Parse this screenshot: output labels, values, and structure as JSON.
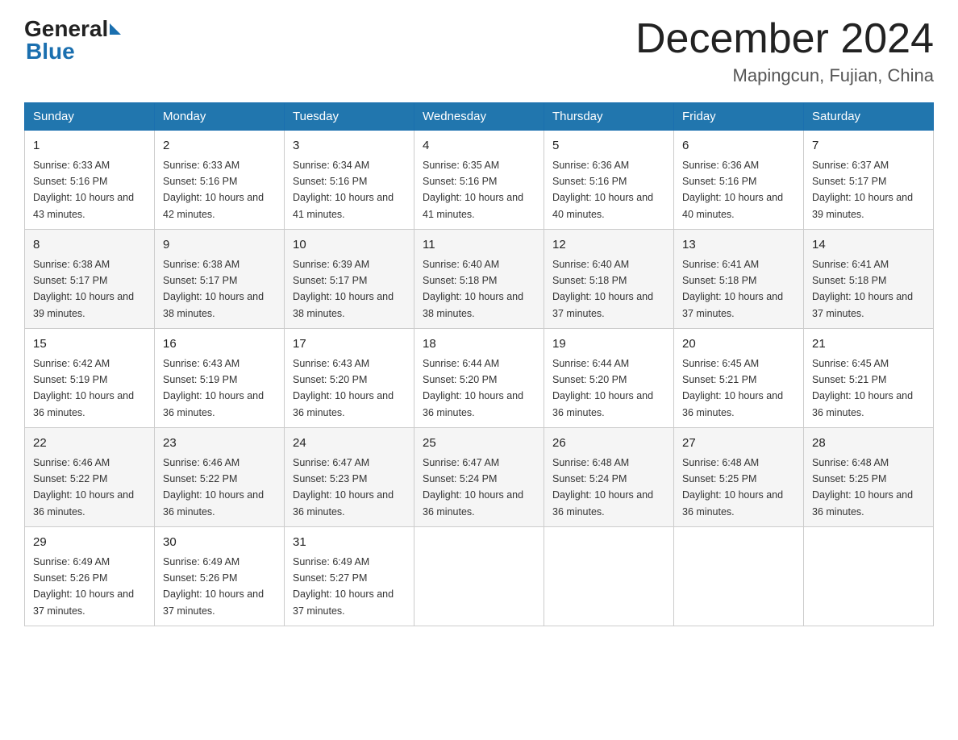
{
  "header": {
    "logo_general": "General",
    "logo_blue": "Blue",
    "month_title": "December 2024",
    "location": "Mapingcun, Fujian, China"
  },
  "days_of_week": [
    "Sunday",
    "Monday",
    "Tuesday",
    "Wednesday",
    "Thursday",
    "Friday",
    "Saturday"
  ],
  "weeks": [
    [
      {
        "day": "1",
        "sunrise": "6:33 AM",
        "sunset": "5:16 PM",
        "daylight": "10 hours and 43 minutes."
      },
      {
        "day": "2",
        "sunrise": "6:33 AM",
        "sunset": "5:16 PM",
        "daylight": "10 hours and 42 minutes."
      },
      {
        "day": "3",
        "sunrise": "6:34 AM",
        "sunset": "5:16 PM",
        "daylight": "10 hours and 41 minutes."
      },
      {
        "day": "4",
        "sunrise": "6:35 AM",
        "sunset": "5:16 PM",
        "daylight": "10 hours and 41 minutes."
      },
      {
        "day": "5",
        "sunrise": "6:36 AM",
        "sunset": "5:16 PM",
        "daylight": "10 hours and 40 minutes."
      },
      {
        "day": "6",
        "sunrise": "6:36 AM",
        "sunset": "5:16 PM",
        "daylight": "10 hours and 40 minutes."
      },
      {
        "day": "7",
        "sunrise": "6:37 AM",
        "sunset": "5:17 PM",
        "daylight": "10 hours and 39 minutes."
      }
    ],
    [
      {
        "day": "8",
        "sunrise": "6:38 AM",
        "sunset": "5:17 PM",
        "daylight": "10 hours and 39 minutes."
      },
      {
        "day": "9",
        "sunrise": "6:38 AM",
        "sunset": "5:17 PM",
        "daylight": "10 hours and 38 minutes."
      },
      {
        "day": "10",
        "sunrise": "6:39 AM",
        "sunset": "5:17 PM",
        "daylight": "10 hours and 38 minutes."
      },
      {
        "day": "11",
        "sunrise": "6:40 AM",
        "sunset": "5:18 PM",
        "daylight": "10 hours and 38 minutes."
      },
      {
        "day": "12",
        "sunrise": "6:40 AM",
        "sunset": "5:18 PM",
        "daylight": "10 hours and 37 minutes."
      },
      {
        "day": "13",
        "sunrise": "6:41 AM",
        "sunset": "5:18 PM",
        "daylight": "10 hours and 37 minutes."
      },
      {
        "day": "14",
        "sunrise": "6:41 AM",
        "sunset": "5:18 PM",
        "daylight": "10 hours and 37 minutes."
      }
    ],
    [
      {
        "day": "15",
        "sunrise": "6:42 AM",
        "sunset": "5:19 PM",
        "daylight": "10 hours and 36 minutes."
      },
      {
        "day": "16",
        "sunrise": "6:43 AM",
        "sunset": "5:19 PM",
        "daylight": "10 hours and 36 minutes."
      },
      {
        "day": "17",
        "sunrise": "6:43 AM",
        "sunset": "5:20 PM",
        "daylight": "10 hours and 36 minutes."
      },
      {
        "day": "18",
        "sunrise": "6:44 AM",
        "sunset": "5:20 PM",
        "daylight": "10 hours and 36 minutes."
      },
      {
        "day": "19",
        "sunrise": "6:44 AM",
        "sunset": "5:20 PM",
        "daylight": "10 hours and 36 minutes."
      },
      {
        "day": "20",
        "sunrise": "6:45 AM",
        "sunset": "5:21 PM",
        "daylight": "10 hours and 36 minutes."
      },
      {
        "day": "21",
        "sunrise": "6:45 AM",
        "sunset": "5:21 PM",
        "daylight": "10 hours and 36 minutes."
      }
    ],
    [
      {
        "day": "22",
        "sunrise": "6:46 AM",
        "sunset": "5:22 PM",
        "daylight": "10 hours and 36 minutes."
      },
      {
        "day": "23",
        "sunrise": "6:46 AM",
        "sunset": "5:22 PM",
        "daylight": "10 hours and 36 minutes."
      },
      {
        "day": "24",
        "sunrise": "6:47 AM",
        "sunset": "5:23 PM",
        "daylight": "10 hours and 36 minutes."
      },
      {
        "day": "25",
        "sunrise": "6:47 AM",
        "sunset": "5:24 PM",
        "daylight": "10 hours and 36 minutes."
      },
      {
        "day": "26",
        "sunrise": "6:48 AM",
        "sunset": "5:24 PM",
        "daylight": "10 hours and 36 minutes."
      },
      {
        "day": "27",
        "sunrise": "6:48 AM",
        "sunset": "5:25 PM",
        "daylight": "10 hours and 36 minutes."
      },
      {
        "day": "28",
        "sunrise": "6:48 AM",
        "sunset": "5:25 PM",
        "daylight": "10 hours and 36 minutes."
      }
    ],
    [
      {
        "day": "29",
        "sunrise": "6:49 AM",
        "sunset": "5:26 PM",
        "daylight": "10 hours and 37 minutes."
      },
      {
        "day": "30",
        "sunrise": "6:49 AM",
        "sunset": "5:26 PM",
        "daylight": "10 hours and 37 minutes."
      },
      {
        "day": "31",
        "sunrise": "6:49 AM",
        "sunset": "5:27 PM",
        "daylight": "10 hours and 37 minutes."
      },
      null,
      null,
      null,
      null
    ]
  ]
}
